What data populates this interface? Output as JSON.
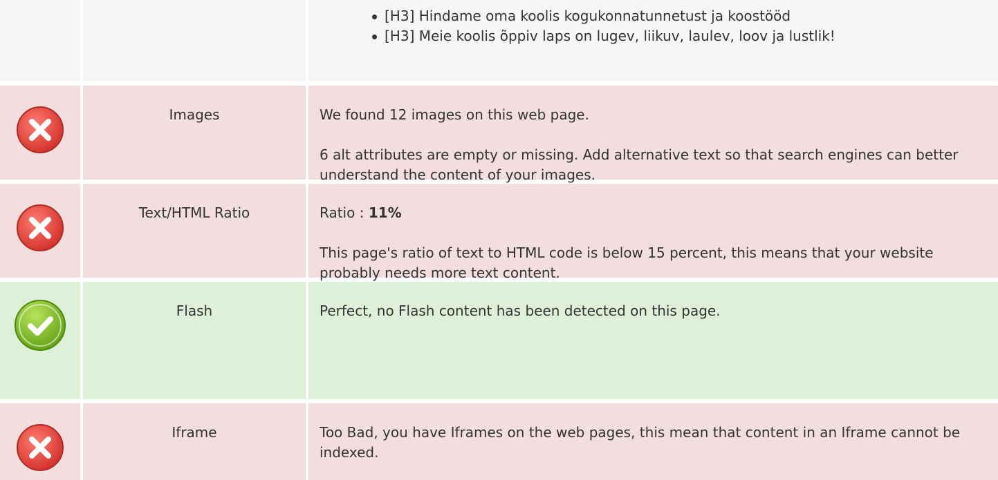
{
  "headings": {
    "items": [
      "[H3] Hindame oma koolis kogukonnatunnetust ja koostööd",
      "[H3] Meie koolis õppiv laps on lugev, liikuv, laulev, loov ja lustlik!"
    ]
  },
  "images": {
    "status_icon": "error-x-icon",
    "label": "Images",
    "paragraph_1": "We found 12 images on this web page.",
    "paragraph_2": "6 alt attributes are empty or missing. Add alternative text so that search engines can better understand the content of your images."
  },
  "text_html_ratio": {
    "status_icon": "error-x-icon",
    "label": "Text/HTML Ratio",
    "ratio_prefix": "Ratio : ",
    "ratio_value": "11%",
    "paragraph_2": "This page's ratio of text to HTML code is below 15 percent, this means that your website probably needs more text content."
  },
  "flash": {
    "status_icon": "success-check-icon",
    "label": "Flash",
    "paragraph_1": "Perfect, no Flash content has been detected on this page."
  },
  "iframe": {
    "status_icon": "error-x-icon",
    "label": "Iframe",
    "paragraph_1": "Too Bad, you have Iframes on the web pages, this mean that content in an Iframe cannot be indexed."
  },
  "colors": {
    "neutral_bg": "#f6f6f6",
    "error_bg": "#f2dede",
    "success_bg": "#dff0d8",
    "error_icon": "#e0403a",
    "success_icon": "#7dbb1f"
  }
}
